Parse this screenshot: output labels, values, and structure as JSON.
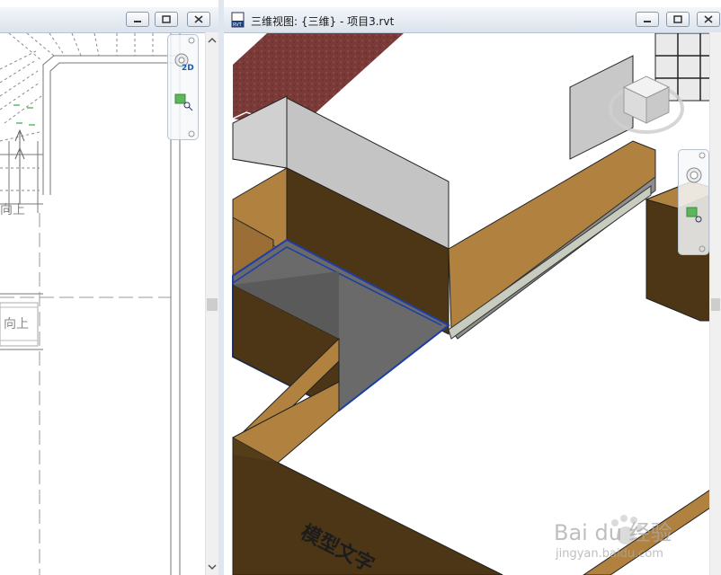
{
  "left_view": {
    "plan_labels": [
      "向上",
      "向上"
    ],
    "navbar": {
      "badge": "2D"
    }
  },
  "right_view": {
    "title": "三维视图: {三维} - 项目3.rvt",
    "model_text": "模型文字"
  },
  "watermark": {
    "brand": "Bai du 经验",
    "url": "jingyan.baidu.com"
  },
  "colors": {
    "floor_tan": "#b0813f",
    "wall_dark": "#4c3616",
    "selection_blue": "#1d3ea6",
    "brick_red": "#7a3a38",
    "glass_grey": "#bcbcbc"
  }
}
